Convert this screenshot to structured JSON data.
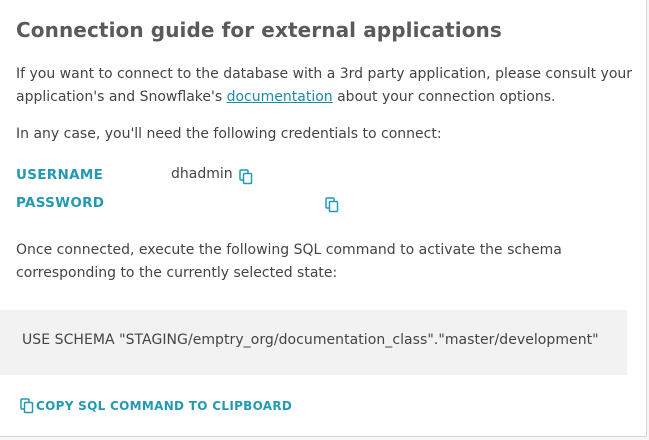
{
  "guide": {
    "title": "Connection guide for external applications",
    "intro_before_link": "If you want to connect to the database with a 3rd party application, please consult your application's and Snowflake's ",
    "intro_link": "documentation",
    "intro_after_link": " about your connection options.",
    "credentials_intro": "In any case, you'll need the following credentials to connect:"
  },
  "credentials": {
    "username_label": "USERNAME",
    "username_value": "dhadmin",
    "password_label": "PASSWORD",
    "password_value": ""
  },
  "sql": {
    "instructions": "Once connected, execute the following SQL command to activate the schema corresponding to the currently selected state:",
    "command": "USE SCHEMA \"STAGING/emptry_org/documentation_class\".\"master/development\"",
    "copy_button_label": "COPY SQL COMMAND TO CLIPBOARD"
  },
  "icons": {
    "copy": "copy-icon"
  },
  "colors": {
    "accent": "#2399b3",
    "link": "#1a8ba6",
    "title": "#5a5a5a",
    "text": "#444444",
    "code_background": "#f2f2f2"
  }
}
